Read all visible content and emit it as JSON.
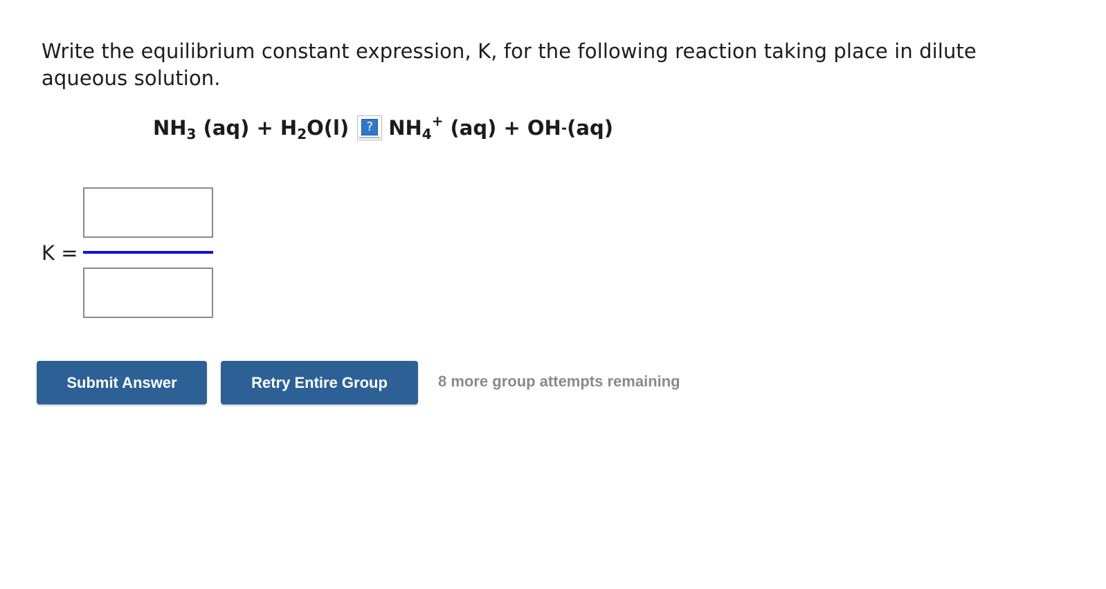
{
  "question": {
    "text": "Write the equilibrium constant expression, K, for the following reaction taking place in dilute aqueous solution."
  },
  "equation": {
    "reactant1_formula": "NH",
    "reactant1_sub": "3",
    "reactant1_state": " (aq) + ",
    "reactant2_formula": "H",
    "reactant2_sub": "2",
    "reactant2_rest": "O(l)",
    "help_symbol": "?",
    "help_icon": "question-mark-icon",
    "product1_formula": "NH",
    "product1_sub": "4",
    "product1_sup": "+",
    "product1_state": " (aq) + OH",
    "product2_sup": "-",
    "product2_state": "(aq)"
  },
  "answer": {
    "k_label": "K =",
    "numerator_value": "",
    "denominator_value": "",
    "fraction_bar_color": "#1010e0"
  },
  "actions": {
    "submit_label": "Submit Answer",
    "retry_label": "Retry Entire Group",
    "attempts_text": "8 more group attempts remaining",
    "button_color": "#2d6196"
  }
}
